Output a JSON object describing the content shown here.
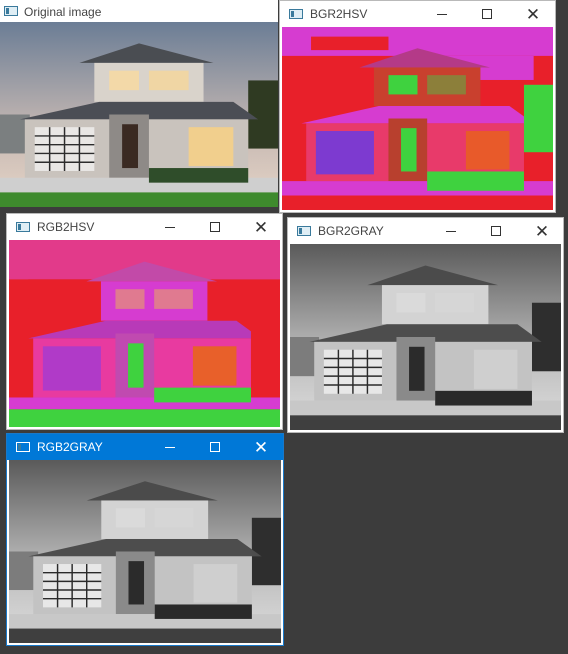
{
  "windows": {
    "original": {
      "title": "Original image",
      "image": "house-photo-color"
    },
    "bgr2hsv": {
      "title": "BGR2HSV",
      "image": "house-hsv-bgr"
    },
    "rgb2hsv": {
      "title": "RGB2HSV",
      "image": "house-hsv-rgb"
    },
    "bgr2gray": {
      "title": "BGR2GRAY",
      "image": "house-grayscale"
    },
    "rgb2gray": {
      "title": "RGB2GRAY",
      "image": "house-grayscale",
      "active": true
    }
  },
  "controls": {
    "minimize": "minimize-icon",
    "maximize": "maximize-icon",
    "close": "close-icon"
  },
  "colors": {
    "desktop": "#3c3c3c",
    "active_titlebar": "#0078d7",
    "hsv_red": "#e8202a",
    "hsv_magenta": "#d63cd0",
    "hsv_green": "#3fd23f"
  }
}
